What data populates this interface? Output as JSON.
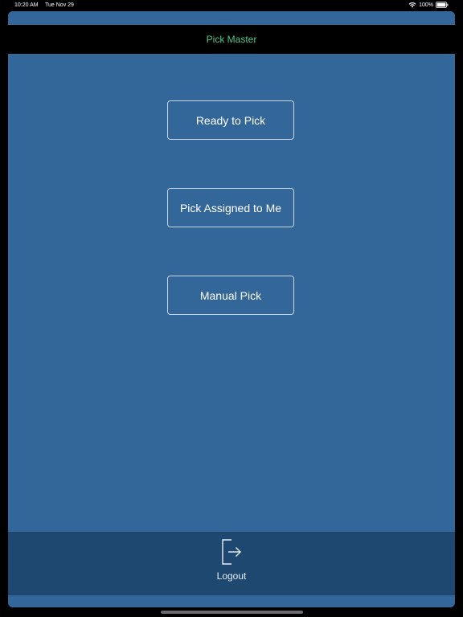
{
  "status_bar": {
    "time": "10:20 AM",
    "date": "Tue Nov 29",
    "battery": "100%",
    "icons": [
      "wifi-icon",
      "battery-icon"
    ]
  },
  "nav": {
    "title": "Pick Master"
  },
  "menu": {
    "buttons": [
      {
        "label": "Ready to Pick"
      },
      {
        "label": "Pick Assigned to Me"
      },
      {
        "label": "Manual Pick"
      }
    ]
  },
  "footer": {
    "logout_label": "Logout",
    "logout_icon": "logout-icon"
  },
  "colors": {
    "background": "#336699",
    "nav_bar": "#000000",
    "nav_title": "#4ec98a",
    "footer": "#1f4870",
    "button_border": "#c9d6e6"
  }
}
